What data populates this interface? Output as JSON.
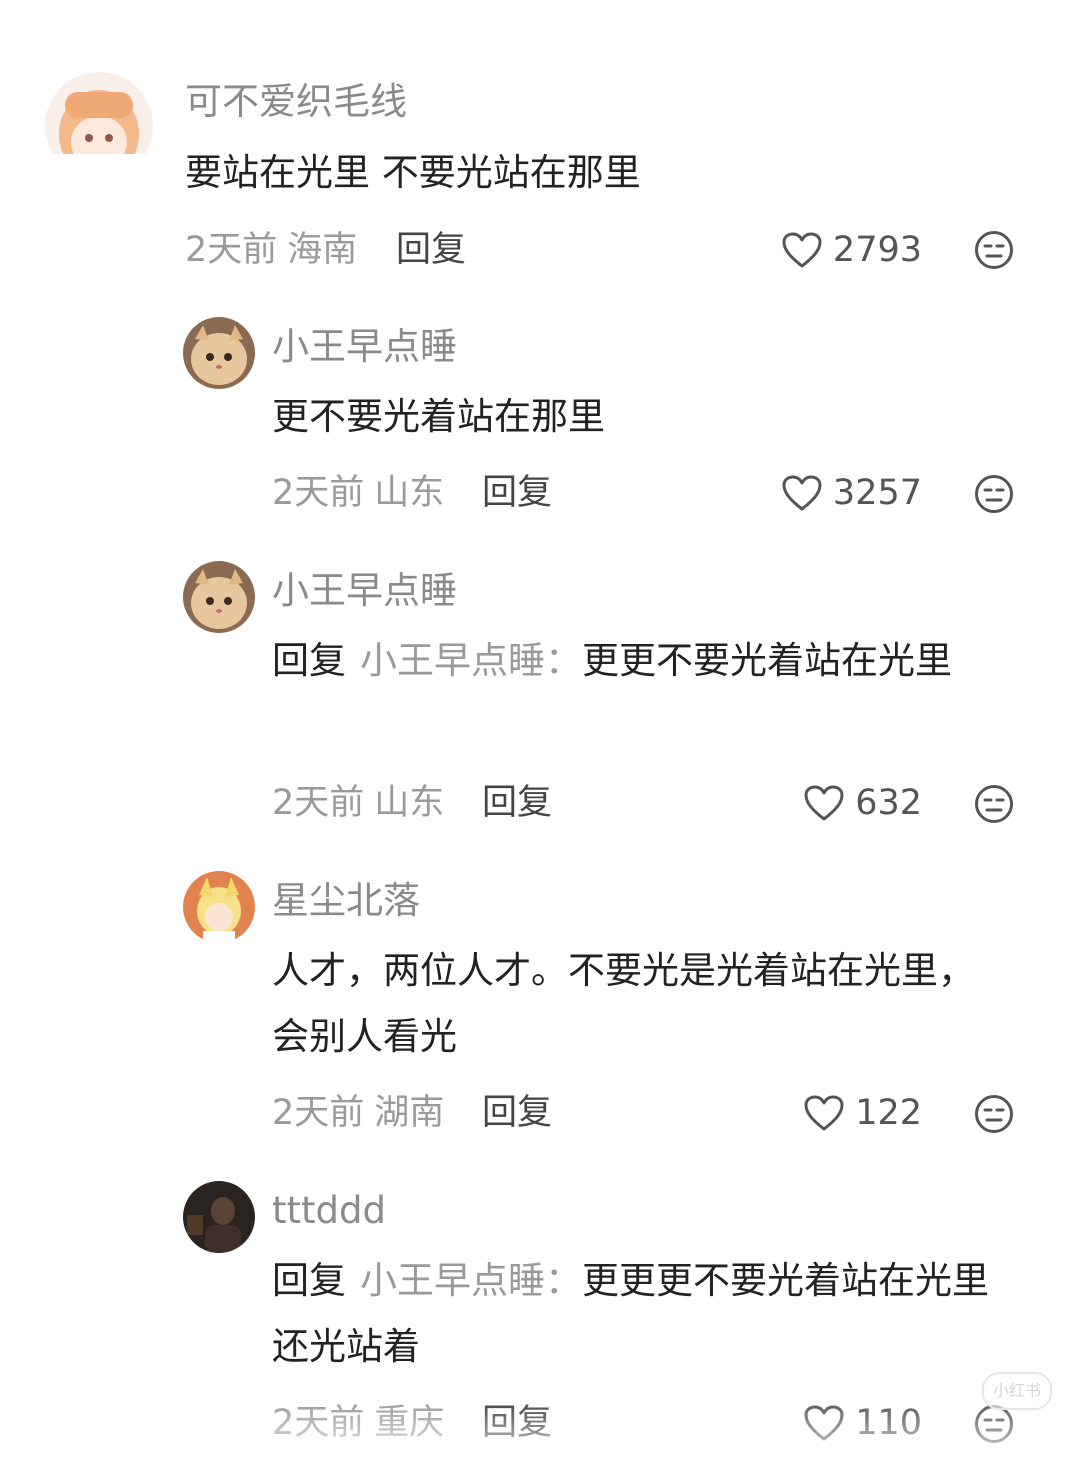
{
  "comments": [
    {
      "username": "可不爱织毛线",
      "text": "要站在光里 不要光站在那里",
      "time": "2天前",
      "location": "海南",
      "reply_label": "回复",
      "likes": "2793"
    },
    {
      "username": "小王早点睡",
      "text": "更不要光着站在那里",
      "time": "2天前",
      "location": "山东",
      "reply_label": "回复",
      "likes": "3257"
    },
    {
      "username": "小王早点睡",
      "reply_prefix": "回复",
      "reply_target": "小王早点睡：",
      "text": "更更不要光着站在光里",
      "time": "2天前",
      "location": "山东",
      "reply_label": "回复",
      "likes": "632"
    },
    {
      "username": "星尘北落",
      "text": "人才，两位人才。不要光是光着站在光里，会别人看光",
      "time": "2天前",
      "location": "湖南",
      "reply_label": "回复",
      "likes": "122"
    },
    {
      "username": "tttddd",
      "reply_prefix": "回复",
      "reply_target": "小王早点睡：",
      "text": "更更更不要光着站在光里还光站着",
      "time": "2天前",
      "location": "重庆",
      "reply_label": "回复",
      "likes": "110"
    }
  ],
  "icons": {
    "like": "heart-outline-icon",
    "dislike": "meh-face-icon"
  },
  "watermark": "小红书"
}
